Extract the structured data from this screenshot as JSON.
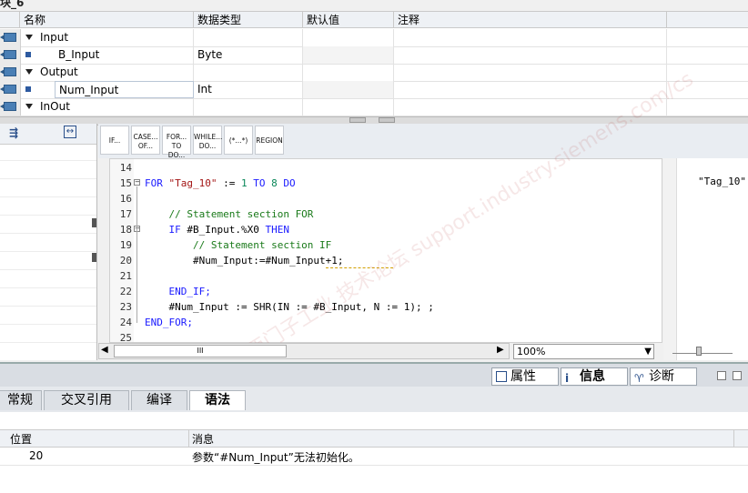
{
  "block_title": "块_6",
  "interface": {
    "headers": [
      "名称",
      "数据类型",
      "默认值",
      "注释"
    ],
    "rows": [
      {
        "kind": "section",
        "name": "Input",
        "type": ""
      },
      {
        "kind": "var",
        "name": "B_Input",
        "type": "Byte"
      },
      {
        "kind": "section",
        "name": "Output",
        "type": ""
      },
      {
        "kind": "var",
        "name": "Num_Input",
        "type": "Int"
      },
      {
        "kind": "section",
        "name": "InOut",
        "type": ""
      }
    ]
  },
  "snippets": [
    "IF...",
    "CASE... OF...",
    "FOR... TO DO...",
    "WHILE... DO...",
    "(*...*)",
    "REGION"
  ],
  "code_lines": [
    {
      "n": "14",
      "text": ""
    },
    {
      "n": "15",
      "text": "FOR \"Tag_10\" := 1 TO 8 DO"
    },
    {
      "n": "16",
      "text": ""
    },
    {
      "n": "17",
      "text": "    // Statement section FOR"
    },
    {
      "n": "18",
      "text": "    IF #B_Input.%X0 THEN"
    },
    {
      "n": "19",
      "text": "        // Statement section IF"
    },
    {
      "n": "20",
      "text": "        #Num_Input:=#Num_Input+1;"
    },
    {
      "n": "21",
      "text": ""
    },
    {
      "n": "22",
      "text": "    END_IF;"
    },
    {
      "n": "23",
      "text": "    #Num_Input := SHR(IN := #B_Input, N := 1); ;"
    },
    {
      "n": "24",
      "text": "END_FOR;"
    },
    {
      "n": "25",
      "text": ""
    }
  ],
  "watch_value": "\"Tag_10\"",
  "scroll_label": "III",
  "zoom": "100%",
  "panel_tabs": [
    "属性",
    "信息",
    "诊断"
  ],
  "sub_tabs": [
    "常规",
    "交叉引用",
    "编译",
    "语法"
  ],
  "messages": {
    "headers": [
      "位置",
      "消息"
    ],
    "rows": [
      {
        "pos": "20",
        "msg": "参数“#Num_Input”无法初始化。"
      }
    ]
  },
  "watermark": "西门子工业 技术论坛 support.industry.siemens.com/cs"
}
